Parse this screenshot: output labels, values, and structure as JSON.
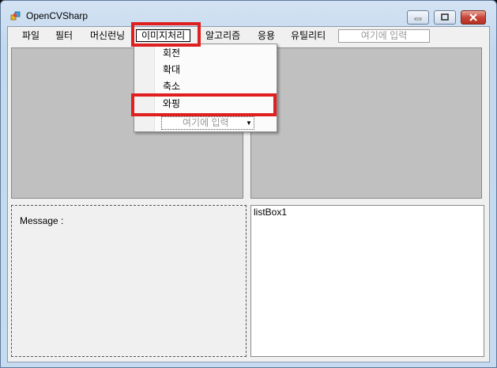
{
  "window": {
    "title": "OpenCVSharp"
  },
  "menubar": {
    "items": [
      {
        "label": "파일"
      },
      {
        "label": "필터"
      },
      {
        "label": "머신런닝"
      },
      {
        "label": "이미지처리"
      },
      {
        "label": "알고리즘"
      },
      {
        "label": "응용"
      },
      {
        "label": "유틸리티"
      }
    ],
    "textbox_placeholder": "여기에 입력"
  },
  "dropdown": {
    "items": [
      {
        "label": "회전"
      },
      {
        "label": "확대"
      },
      {
        "label": "축소"
      },
      {
        "label": "와핑"
      }
    ],
    "combo_placeholder": "여기에 입력"
  },
  "message": {
    "label": "Message :"
  },
  "listbox": {
    "label": "listBox1"
  },
  "colors": {
    "highlight": "#e02020",
    "picture_bg": "#c0c0c0"
  },
  "icons": {
    "app": "opencv-app-icon",
    "minimize": "minimize-icon",
    "maximize": "maximize-icon",
    "close": "close-icon"
  }
}
